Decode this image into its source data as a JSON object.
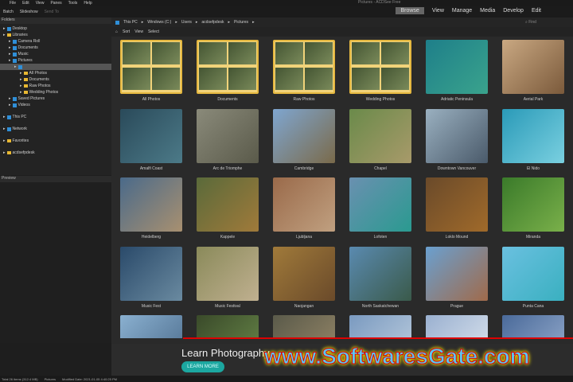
{
  "app": {
    "title": "Pictures - ACDSee Free"
  },
  "menu": [
    "File",
    "Edit",
    "View",
    "Panes",
    "Tools",
    "Help"
  ],
  "toolbar": {
    "batch": "Batch",
    "slideshow": "Slideshow",
    "sendto": "Send To"
  },
  "modes": [
    "Browse",
    "View",
    "Manage",
    "Media",
    "Develop",
    "Edit"
  ],
  "folders": {
    "title": "Folders",
    "items": [
      {
        "label": "Desktop",
        "level": 0,
        "icon": "blue"
      },
      {
        "label": "Libraries",
        "level": 0,
        "icon": "folder"
      },
      {
        "label": "Camera Roll",
        "level": 1,
        "icon": "blue"
      },
      {
        "label": "Documents",
        "level": 1,
        "icon": "blue"
      },
      {
        "label": "Music",
        "level": 1,
        "icon": "blue"
      },
      {
        "label": "Pictures",
        "level": 1,
        "icon": "blue"
      },
      {
        "label": "",
        "level": 2,
        "icon": "blue",
        "selected": true
      },
      {
        "label": "All Photos",
        "level": 3,
        "icon": "folder"
      },
      {
        "label": "Documents",
        "level": 3,
        "icon": "folder"
      },
      {
        "label": "Raw Photos",
        "level": 3,
        "icon": "folder"
      },
      {
        "label": "Wedding Photos",
        "level": 3,
        "icon": "folder"
      },
      {
        "label": "Saved Pictures",
        "level": 1,
        "icon": "blue"
      },
      {
        "label": "Videos",
        "level": 1,
        "icon": "blue"
      },
      {
        "label": "This PC",
        "level": 0,
        "icon": "blue",
        "gap": true
      },
      {
        "label": "Network",
        "level": 0,
        "icon": "blue",
        "gap": true
      },
      {
        "label": "Favorites",
        "level": 0,
        "icon": "folder",
        "gap": true
      },
      {
        "label": "acdsefpdesk",
        "level": 0,
        "icon": "folder",
        "gap": true
      }
    ]
  },
  "preview": {
    "title": "Preview"
  },
  "breadcrumb": [
    "This PC",
    "Windows (C:)",
    "Users",
    "acdsefpdesk",
    "Pictures"
  ],
  "sortbar": {
    "sort": "Sort",
    "view": "View",
    "select": "Select"
  },
  "search": {
    "placeholder": "Find"
  },
  "items": [
    {
      "label": "All Photos",
      "folder": true
    },
    {
      "label": "Documents",
      "folder": true
    },
    {
      "label": "Raw Photos",
      "folder": true
    },
    {
      "label": "Wedding Photos",
      "folder": true
    },
    {
      "label": "Adriatic Peninsula",
      "c1": "#1e7f8a",
      "c2": "#3aa38c"
    },
    {
      "label": "Aerial Park",
      "c1": "#c9a882",
      "c2": "#7b5a3b"
    },
    {
      "label": "Amalfi Coast",
      "c1": "#2a4a5a",
      "c2": "#4c7a88"
    },
    {
      "label": "Arc de Triomphe",
      "c1": "#8a8a7a",
      "c2": "#5a5a4a"
    },
    {
      "label": "Cambridge",
      "c1": "#7fa6d0",
      "c2": "#7a6a4a"
    },
    {
      "label": "Chapel",
      "c1": "#6a8a4a",
      "c2": "#a89a6a"
    },
    {
      "label": "Downtown Vancouver",
      "c1": "#9ab0c0",
      "c2": "#4a5a6a"
    },
    {
      "label": "El Nido",
      "c1": "#2a9ab8",
      "c2": "#7ad0e0"
    },
    {
      "label": "Heidelberg",
      "c1": "#4a6a8a",
      "c2": "#a89070"
    },
    {
      "label": "Kappele",
      "c1": "#5a6a3a",
      "c2": "#a07a3a"
    },
    {
      "label": "Ljubljana",
      "c1": "#9a6a4a",
      "c2": "#c0a080"
    },
    {
      "label": "Lofoten",
      "c1": "#6a90b0",
      "c2": "#2a9a90"
    },
    {
      "label": "Loklo Mound",
      "c1": "#6a4a2a",
      "c2": "#a06a2a"
    },
    {
      "label": "Miranda",
      "c1": "#3a7a2a",
      "c2": "#7ab04a"
    },
    {
      "label": "Music Fest",
      "c1": "#2a4a6a",
      "c2": "#6a8aa0"
    },
    {
      "label": "Music Festival",
      "c1": "#8a8a5a",
      "c2": "#c0b090"
    },
    {
      "label": "Naojangan",
      "c1": "#a07a3a",
      "c2": "#6a4a2a"
    },
    {
      "label": "North Saskatchewan",
      "c1": "#5a8ab0",
      "c2": "#3a5a4a"
    },
    {
      "label": "Prague",
      "c1": "#6aa0d0",
      "c2": "#a06a4a"
    },
    {
      "label": "Punta Cana",
      "c1": "#6ac0e0",
      "c2": "#3ab0c0"
    },
    {
      "label": "",
      "c1": "#8ab0d0",
      "c2": "#4a6a8a"
    },
    {
      "label": "",
      "c1": "#3a4a2a",
      "c2": "#6a8a4a"
    },
    {
      "label": "",
      "c1": "#5a5a4a",
      "c2": "#9a8a6a"
    },
    {
      "label": "",
      "c1": "#7a9ac0",
      "c2": "#c0d0e0"
    },
    {
      "label": "",
      "c1": "#9ab0d0",
      "c2": "#e0e8f0"
    },
    {
      "label": "",
      "c1": "#4a6a9a",
      "c2": "#9ab0d0"
    }
  ],
  "ad": {
    "headline": "Learn Photography",
    "button": "LEARN MORE",
    "watermark": "www.SoftwaresGate.com"
  },
  "status": {
    "total": "Total 26 items (312.4 MB)",
    "location": "Pictures",
    "modified": "Modified Date: 2021-01-05 4:40:25 PM"
  },
  "colors": {
    "accent": "#1ca7a0",
    "folder": "#e8b832",
    "selection": "#555555"
  }
}
